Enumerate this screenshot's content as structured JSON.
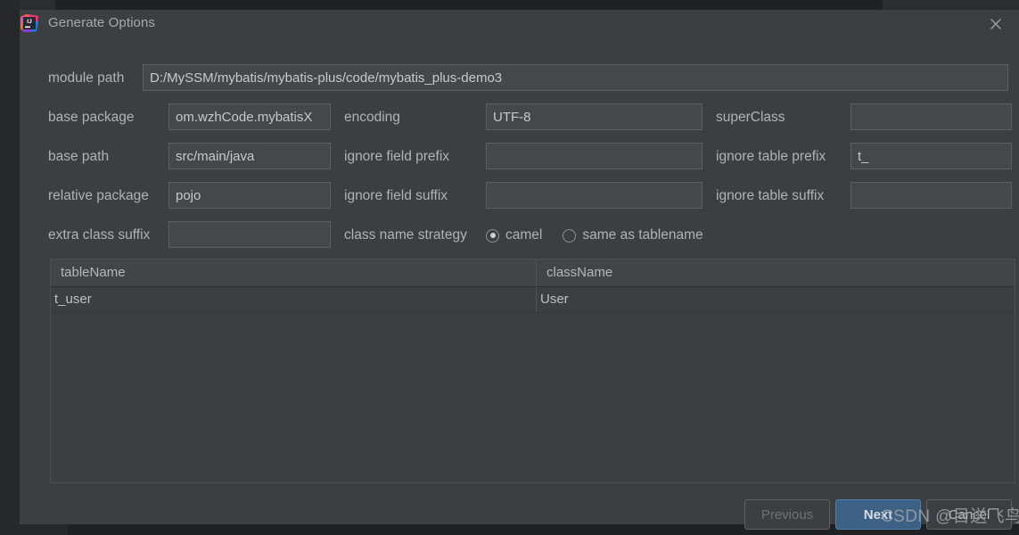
{
  "window": {
    "title": "Generate Options",
    "app_icon": "intellij-idea-icon",
    "close_icon": "close-icon"
  },
  "form": {
    "module_path": {
      "label": "module path",
      "value": "D:/MySSM/mybatis/mybatis-plus/code/mybatis_plus-demo3",
      "placeholder": ""
    },
    "base_package": {
      "label": "base package",
      "value": "om.wzhCode.mybatisX",
      "placeholder": ""
    },
    "base_path": {
      "label": "base path",
      "value": "src/main/java",
      "placeholder": ""
    },
    "relative_package": {
      "label": "relative package",
      "value": "pojo",
      "placeholder": ""
    },
    "extra_class_suffix": {
      "label": "extra class suffix",
      "value": "",
      "placeholder": ""
    },
    "encoding": {
      "label": "encoding",
      "value": "UTF-8",
      "placeholder": ""
    },
    "ignore_field_prefix": {
      "label": "ignore field prefix",
      "value": "",
      "placeholder": ""
    },
    "ignore_field_suffix": {
      "label": "ignore field suffix",
      "value": "",
      "placeholder": ""
    },
    "super_class": {
      "label": "superClass",
      "value": "",
      "placeholder": ""
    },
    "ignore_table_prefix": {
      "label": "ignore table prefix",
      "value": "t_",
      "placeholder": ""
    },
    "ignore_table_suffix": {
      "label": "ignore table suffix",
      "value": "",
      "placeholder": ""
    },
    "class_name_strategy": {
      "label": "class name strategy",
      "options": [
        {
          "label": "camel",
          "selected": true
        },
        {
          "label": "same as tablename",
          "selected": false
        }
      ]
    }
  },
  "table": {
    "columns": [
      "tableName",
      "className"
    ],
    "rows": [
      {
        "tableName": "t_user",
        "className": "User"
      }
    ]
  },
  "buttons": {
    "previous": {
      "label": "Previous",
      "enabled": false
    },
    "next": {
      "label": "Next",
      "enabled": true,
      "primary": true,
      "color": "#3d6185"
    },
    "cancel": {
      "label": "Cancel",
      "enabled": true
    }
  },
  "watermark": {
    "text": "CSDN @目送飞鸟"
  }
}
